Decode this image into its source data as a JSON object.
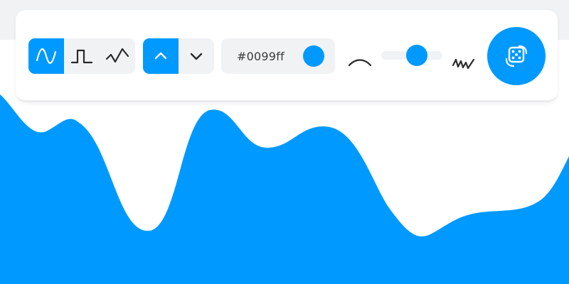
{
  "colors": {
    "accent": "#0099ff",
    "icon_dark": "#2a2a2a",
    "control_bg": "#f1f2f4"
  },
  "toolbar": {
    "wave_types": [
      {
        "icon": "sine-wave-icon",
        "active": true
      },
      {
        "icon": "square-wave-icon",
        "active": false
      },
      {
        "icon": "triangle-wave-icon",
        "active": false
      }
    ],
    "direction": [
      {
        "icon": "chevron-up-icon",
        "active": true
      },
      {
        "icon": "chevron-down-icon",
        "active": false
      }
    ],
    "color": {
      "value": "#0099ff"
    },
    "complexity": {
      "min_icon": "smooth-curve-icon",
      "max_icon": "noisy-wave-icon",
      "level": 0.58
    },
    "randomize": {
      "icon": "dice-icon"
    }
  }
}
